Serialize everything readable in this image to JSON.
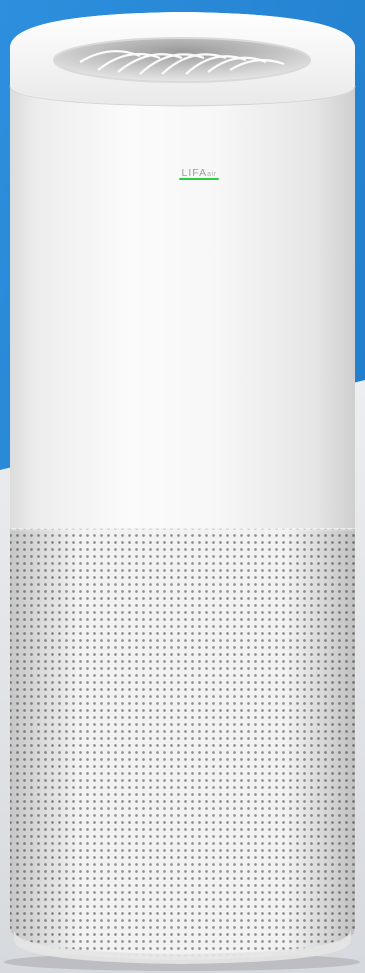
{
  "product": {
    "brand_logo_text": "LIFA",
    "brand_logo_suffix": "air",
    "status_led_color": "#2ecc40"
  },
  "colors": {
    "background_blue": "#2a8ad8",
    "background_gray": "#e2e5e9",
    "body_white": "#f6f6f6"
  }
}
